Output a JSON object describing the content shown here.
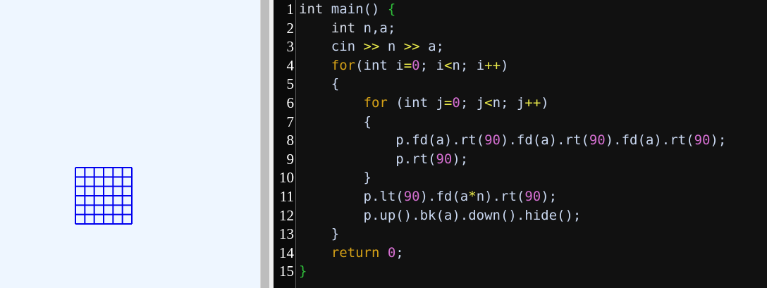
{
  "colors": {
    "canvas_bg": "#eef6ff",
    "grid_stroke": "#0000ee",
    "editor_bg": "#111111",
    "keyword_control": "#d4a017",
    "number": "#d46fd0",
    "operator": "#e8e84a",
    "brace_outer": "#2fbf3a",
    "text": "#c9d7f0"
  },
  "turtle_grid": {
    "cells_per_side": 6,
    "note_name": "drawn-grid"
  },
  "editor": {
    "line_numbers": [
      "1",
      "2",
      "3",
      "4",
      "5",
      "6",
      "7",
      "8",
      "9",
      "10",
      "11",
      "12",
      "13",
      "14",
      "15"
    ],
    "lines": [
      [
        {
          "t": "int",
          "c": "kw-type"
        },
        {
          "t": " main",
          "c": "ident"
        },
        {
          "t": "()",
          "c": "punct"
        },
        {
          "t": " {",
          "c": "brace-g"
        }
      ],
      [
        {
          "t": "    int",
          "c": "kw-type"
        },
        {
          "t": " n,a;",
          "c": "ident"
        }
      ],
      [
        {
          "t": "    cin",
          "c": "ident"
        },
        {
          "t": " >>",
          "c": "op"
        },
        {
          "t": " n",
          "c": "ident"
        },
        {
          "t": " >>",
          "c": "op"
        },
        {
          "t": " a;",
          "c": "ident"
        }
      ],
      [
        {
          "t": "    for",
          "c": "kw-ctrl"
        },
        {
          "t": "(int i",
          "c": "ident"
        },
        {
          "t": "=",
          "c": "op"
        },
        {
          "t": "0",
          "c": "num"
        },
        {
          "t": "; i",
          "c": "ident"
        },
        {
          "t": "<",
          "c": "op"
        },
        {
          "t": "n; i",
          "c": "ident"
        },
        {
          "t": "++",
          "c": "op"
        },
        {
          "t": ")",
          "c": "punct"
        }
      ],
      [
        {
          "t": "    {",
          "c": "brace"
        }
      ],
      [
        {
          "t": "        for",
          "c": "kw-ctrl"
        },
        {
          "t": " (int j",
          "c": "ident"
        },
        {
          "t": "=",
          "c": "op"
        },
        {
          "t": "0",
          "c": "num"
        },
        {
          "t": "; j",
          "c": "ident"
        },
        {
          "t": "<",
          "c": "op"
        },
        {
          "t": "n; j",
          "c": "ident"
        },
        {
          "t": "++",
          "c": "op"
        },
        {
          "t": ")",
          "c": "punct"
        }
      ],
      [
        {
          "t": "        {",
          "c": "brace"
        }
      ],
      [
        {
          "t": "            p.fd(a).rt(",
          "c": "ident"
        },
        {
          "t": "90",
          "c": "num"
        },
        {
          "t": ").fd(a).rt(",
          "c": "ident"
        },
        {
          "t": "90",
          "c": "num"
        },
        {
          "t": ").fd(a).rt(",
          "c": "ident"
        },
        {
          "t": "90",
          "c": "num"
        },
        {
          "t": ");",
          "c": "punct"
        }
      ],
      [
        {
          "t": "            p.rt(",
          "c": "ident"
        },
        {
          "t": "90",
          "c": "num"
        },
        {
          "t": ");",
          "c": "punct"
        }
      ],
      [
        {
          "t": "        }",
          "c": "brace"
        }
      ],
      [
        {
          "t": "        p.lt(",
          "c": "ident"
        },
        {
          "t": "90",
          "c": "num"
        },
        {
          "t": ").fd(a",
          "c": "ident"
        },
        {
          "t": "*",
          "c": "op"
        },
        {
          "t": "n).rt(",
          "c": "ident"
        },
        {
          "t": "90",
          "c": "num"
        },
        {
          "t": ");",
          "c": "punct"
        }
      ],
      [
        {
          "t": "        p.up().bk(a).down().hide();",
          "c": "ident"
        }
      ],
      [
        {
          "t": "    }",
          "c": "brace"
        }
      ],
      [
        {
          "t": "    return",
          "c": "kw-ctrl"
        },
        {
          "t": " ",
          "c": "ident"
        },
        {
          "t": "0",
          "c": "num"
        },
        {
          "t": ";",
          "c": "punct"
        }
      ],
      [
        {
          "t": "}",
          "c": "brace-g"
        }
      ]
    ]
  }
}
